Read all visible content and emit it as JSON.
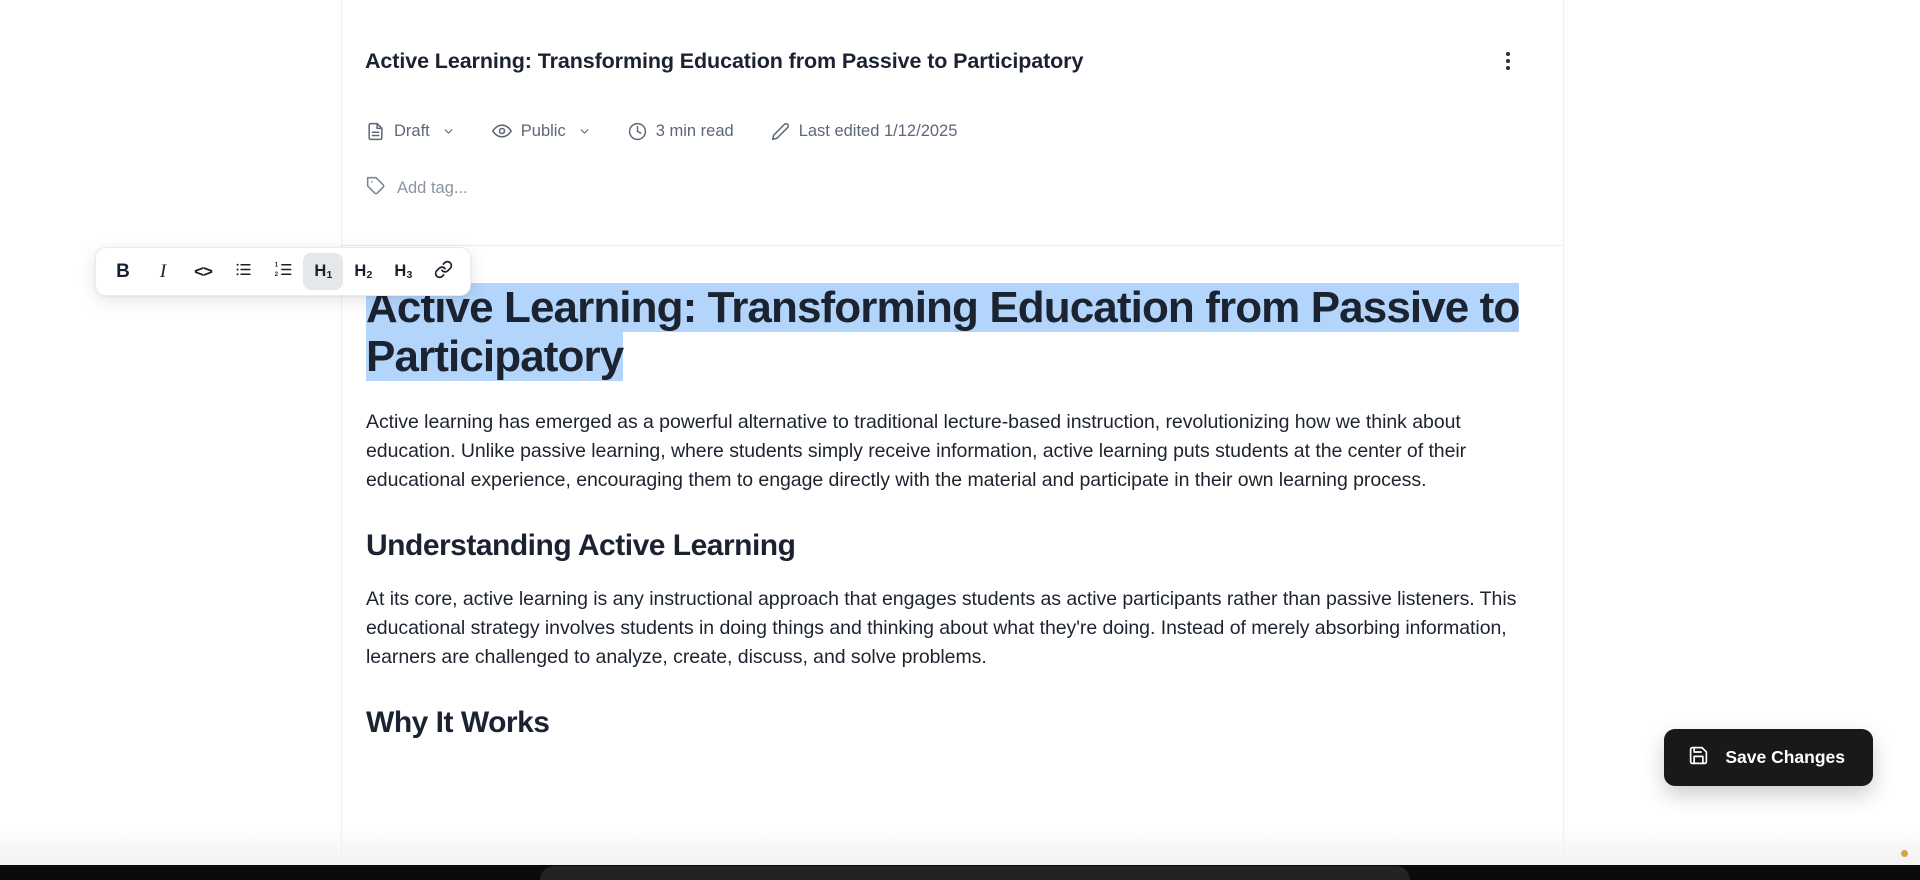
{
  "header": {
    "doc_title": "Active Learning: Transforming Education from Passive to Participatory",
    "kebab_label": "More options",
    "meta": [
      {
        "icon": "document-icon",
        "label": "Draft",
        "has_chevron": true
      },
      {
        "icon": "eye-icon",
        "label": "Public",
        "has_chevron": true
      },
      {
        "icon": "clock-icon",
        "label": "3 min read",
        "has_chevron": false
      },
      {
        "icon": "pencil-icon",
        "label": "Last edited 1/12/2025",
        "has_chevron": false
      }
    ],
    "tag": {
      "icon": "tag-icon",
      "value": "",
      "placeholder": "Add tag..."
    }
  },
  "toolbar": {
    "buttons": [
      {
        "name": "bold-button",
        "glyph": "B",
        "kind": "bold",
        "active": false
      },
      {
        "name": "italic-button",
        "glyph": "I",
        "kind": "italic",
        "active": false
      },
      {
        "name": "code-button",
        "glyph": "<>",
        "kind": "code",
        "active": false
      },
      {
        "name": "bullet-list-button",
        "glyph": "",
        "kind": "bullet",
        "active": false
      },
      {
        "name": "numbered-list-button",
        "glyph": "",
        "kind": "numbered",
        "active": false
      },
      {
        "name": "heading-1-button",
        "glyph": "H",
        "sub": "1",
        "kind": "heading",
        "active": true
      },
      {
        "name": "heading-2-button",
        "glyph": "H",
        "sub": "2",
        "kind": "heading",
        "active": false
      },
      {
        "name": "heading-3-button",
        "glyph": "H",
        "sub": "3",
        "kind": "heading",
        "active": false
      },
      {
        "name": "link-button",
        "glyph": "",
        "kind": "link",
        "active": false
      }
    ]
  },
  "document": {
    "title": "Active Learning: Transforming Education from Passive to Participatory",
    "title_selected": true,
    "blocks": [
      {
        "type": "paragraph",
        "text": "Active learning has emerged as a powerful alternative to traditional lecture-based instruction, revolutionizing how we think about education. Unlike passive learning, where students simply receive information, active learning puts students at the center of their educational experience, encouraging them to engage directly with the material and participate in their own learning process."
      },
      {
        "type": "h2",
        "text": "Understanding Active Learning"
      },
      {
        "type": "paragraph",
        "text": "At its core, active learning is any instructional approach that engages students as active participants rather than passive listeners. This educational strategy involves students in doing things and thinking about what they're doing. Instead of merely absorbing information, learners are challenged to analyze, create, discuss, and solve problems."
      },
      {
        "type": "h2",
        "text": "Why It Works"
      }
    ]
  },
  "actions": {
    "save_label": "Save Changes",
    "save_icon": "floppy-disk-icon"
  },
  "colors": {
    "selection_highlight": "#b4d5fb",
    "text_primary": "#1b2230",
    "text_muted": "#5d6778",
    "save_button_bg": "#191919",
    "toolbar_active_bg": "#e6e7ea"
  }
}
